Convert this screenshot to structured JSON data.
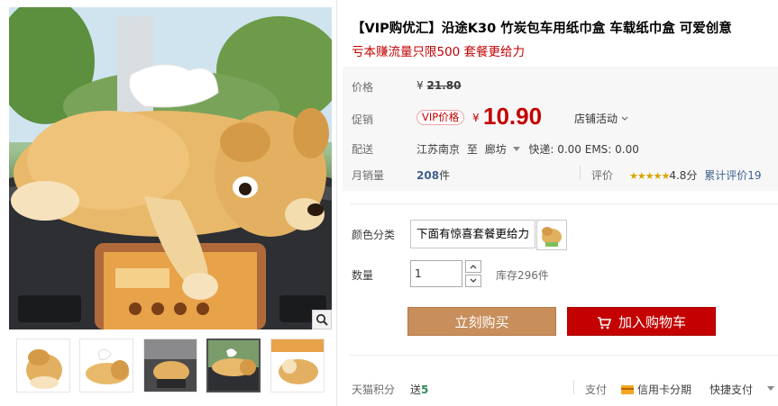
{
  "product": {
    "title": "【VIP购优汇】沿途K30 竹炭包车用纸巾盒 车载纸巾盒 可爱创意",
    "subtitle": "亏本赚流量只限500 套餐更给力"
  },
  "price": {
    "label": "价格",
    "currency": "¥",
    "original": "21.80"
  },
  "promo": {
    "label": "促销",
    "badge": "VIP价格",
    "currency": "¥",
    "price": "10.90",
    "store_activity": "店铺活动"
  },
  "shipping": {
    "label": "配送",
    "from": "江苏南京",
    "to_word": "至",
    "destination": "廊坊",
    "fees": "快递: 0.00 EMS: 0.00"
  },
  "sales": {
    "label": "月销量",
    "count": "208",
    "unit": "件"
  },
  "rating": {
    "label": "评价",
    "stars": "★★★★★",
    "score": "4.8分",
    "total_text": "累计评价19"
  },
  "color": {
    "label": "颜色分类",
    "option_text": "下面有惊喜套餐更给力"
  },
  "quantity": {
    "label": "数量",
    "value": "1",
    "stock": "库存296件"
  },
  "actions": {
    "buy_now": "立刻购买",
    "add_to_cart": "加入购物车"
  },
  "footer": {
    "points_label": "天猫积分",
    "points_prefix": "送",
    "points_value": "5",
    "pay_label": "支付",
    "credit": "信用卡分期",
    "quick_pay": "快捷支付"
  },
  "colors": {
    "accent_red": "#c40000",
    "buy_button": "#c88e5c",
    "link_blue": "#3f5f8f",
    "star_gold": "#d9a500"
  },
  "icons": [
    "zoom-icon",
    "chevron-down-icon",
    "triangle-down-icon",
    "star-icon",
    "credit-card-icon",
    "cart-icon",
    "arrow-up-icon",
    "arrow-down-icon"
  ]
}
